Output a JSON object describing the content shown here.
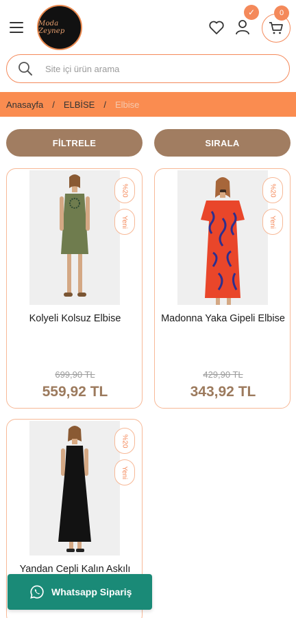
{
  "header": {
    "logo_text": "Moda Zeynep",
    "user_badge": "✓",
    "cart_count": "0"
  },
  "search": {
    "placeholder": "Site içi ürün arama"
  },
  "breadcrumb": {
    "items": [
      "Anasayfa",
      "ELBİSE",
      "Elbise"
    ],
    "separator": "/"
  },
  "actions": {
    "filter_label": "FİLTRELE",
    "sort_label": "SIRALA"
  },
  "products": [
    {
      "name": "Kolyeli Kolsuz Elbise",
      "discount": "%20",
      "badge": "Yeni",
      "old_price": "699,90 TL",
      "new_price": "559,92 TL"
    },
    {
      "name": "Madonna Yaka Gipeli Elbise",
      "discount": "%20",
      "badge": "Yeni",
      "old_price": "429,90 TL",
      "new_price": "343,92 TL"
    },
    {
      "name": "Yandan Cepli Kalın Askılı",
      "discount": "%20",
      "badge": "Yeni",
      "old_price": "",
      "new_price": ""
    }
  ],
  "whatsapp": {
    "label": "Whatsapp Sipariş"
  },
  "colors": {
    "accent": "#fa8c50",
    "button": "#a17d61",
    "price": "#9c7a5d",
    "whatsapp": "#1a8a77"
  }
}
